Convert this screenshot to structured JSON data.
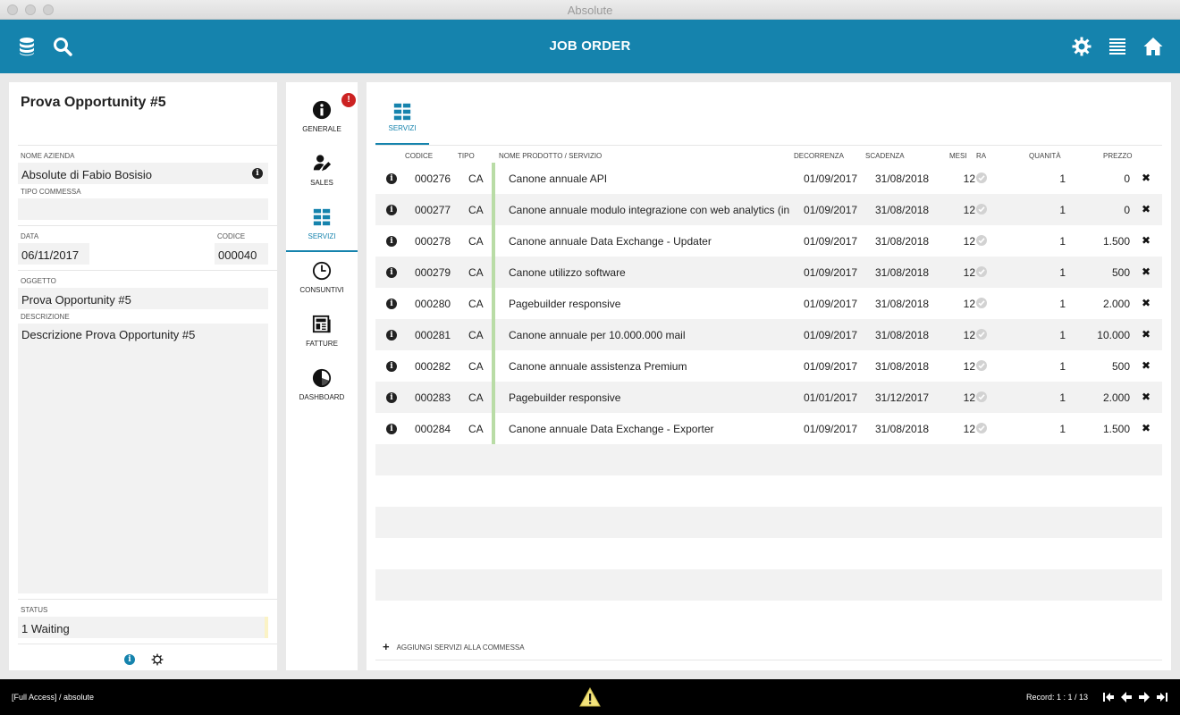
{
  "window": {
    "title": "Absolute"
  },
  "header": {
    "title": "JOB ORDER"
  },
  "left": {
    "title": "Prova Opportunity #5",
    "nome_azienda_label": "NOME AZIENDA",
    "nome_azienda_value": "Absolute di Fabio Bosisio",
    "tipo_commessa_label": "TIPO COMMESSA",
    "tipo_commessa_value": "",
    "data_label": "DATA",
    "data_value": "06/11/2017",
    "codice_label": "CODICE",
    "codice_value": "000040",
    "oggetto_label": "OGGETTO",
    "oggetto_value": "Prova Opportunity #5",
    "descrizione_label": "DESCRIZIONE",
    "descrizione_value": "Descrizione Prova Opportunity #5",
    "status_label": "STATUS",
    "status_value": "1 Waiting"
  },
  "nav": {
    "badge": "!",
    "items": [
      {
        "label": "GENERALE",
        "icon": "info-icon"
      },
      {
        "label": "SALES",
        "icon": "user-edit-icon"
      },
      {
        "label": "SERVIZI",
        "icon": "grid-icon"
      },
      {
        "label": "CONSUNTIVI",
        "icon": "clock-icon"
      },
      {
        "label": "FATTURE",
        "icon": "newspaper-icon"
      },
      {
        "label": "DASHBOARD",
        "icon": "pie-chart-icon"
      }
    ]
  },
  "tab": {
    "label": "SERVIZI"
  },
  "table": {
    "headers": {
      "codice": "CODICE",
      "tipo": "TIPO",
      "nome": "NOME PRODOTTO / SERVIZIO",
      "decorrenza": "DECORRENZA",
      "scadenza": "SCADENZA",
      "mesi": "MESI",
      "ra": "RA",
      "quantita": "QUANITÀ",
      "prezzo": "PREZZO"
    },
    "rows": [
      {
        "codice": "000276",
        "tipo": "CA",
        "nome": "Canone annuale API",
        "decorrenza": "01/09/2017",
        "scadenza": "31/08/2018",
        "mesi": "12",
        "quantita": "1",
        "prezzo": "0"
      },
      {
        "codice": "000277",
        "tipo": "CA",
        "nome": "Canone annuale modulo integrazione con web analytics  (in",
        "decorrenza": "01/09/2017",
        "scadenza": "31/08/2018",
        "mesi": "12",
        "quantita": "1",
        "prezzo": "0"
      },
      {
        "codice": "000278",
        "tipo": "CA",
        "nome": "Canone annuale Data Exchange - Updater",
        "decorrenza": "01/09/2017",
        "scadenza": "31/08/2018",
        "mesi": "12",
        "quantita": "1",
        "prezzo": "1.500"
      },
      {
        "codice": "000279",
        "tipo": "CA",
        "nome": "Canone utilizzo software",
        "decorrenza": "01/09/2017",
        "scadenza": "31/08/2018",
        "mesi": "12",
        "quantita": "1",
        "prezzo": "500"
      },
      {
        "codice": "000280",
        "tipo": "CA",
        "nome": "Pagebuilder responsive",
        "decorrenza": "01/09/2017",
        "scadenza": "31/08/2018",
        "mesi": "12",
        "quantita": "1",
        "prezzo": "2.000"
      },
      {
        "codice": "000281",
        "tipo": "CA",
        "nome": "Canone annuale per 10.000.000 mail",
        "decorrenza": "01/09/2017",
        "scadenza": "31/08/2018",
        "mesi": "12",
        "quantita": "1",
        "prezzo": "10.000"
      },
      {
        "codice": "000282",
        "tipo": "CA",
        "nome": "Canone annuale assistenza Premium",
        "decorrenza": "01/09/2017",
        "scadenza": "31/08/2018",
        "mesi": "12",
        "quantita": "1",
        "prezzo": "500"
      },
      {
        "codice": "000283",
        "tipo": "CA",
        "nome": "Pagebuilder responsive",
        "decorrenza": "01/01/2017",
        "scadenza": "31/12/2017",
        "mesi": "12",
        "quantita": "1",
        "prezzo": "2.000"
      },
      {
        "codice": "000284",
        "tipo": "CA",
        "nome": "Canone annuale Data Exchange - Exporter",
        "decorrenza": "01/09/2017",
        "scadenza": "31/08/2018",
        "mesi": "12",
        "quantita": "1",
        "prezzo": "1.500"
      }
    ],
    "add_label": "AGGIUNGI SERVIZI ALLA COMMESSA"
  },
  "footer": {
    "access": "[Full Access] / absolute",
    "record": "Record: 1 : 1 / 13"
  },
  "colors": {
    "accent": "#1583ad",
    "badge": "#cc2222",
    "status_ok": "#b9dca6"
  }
}
